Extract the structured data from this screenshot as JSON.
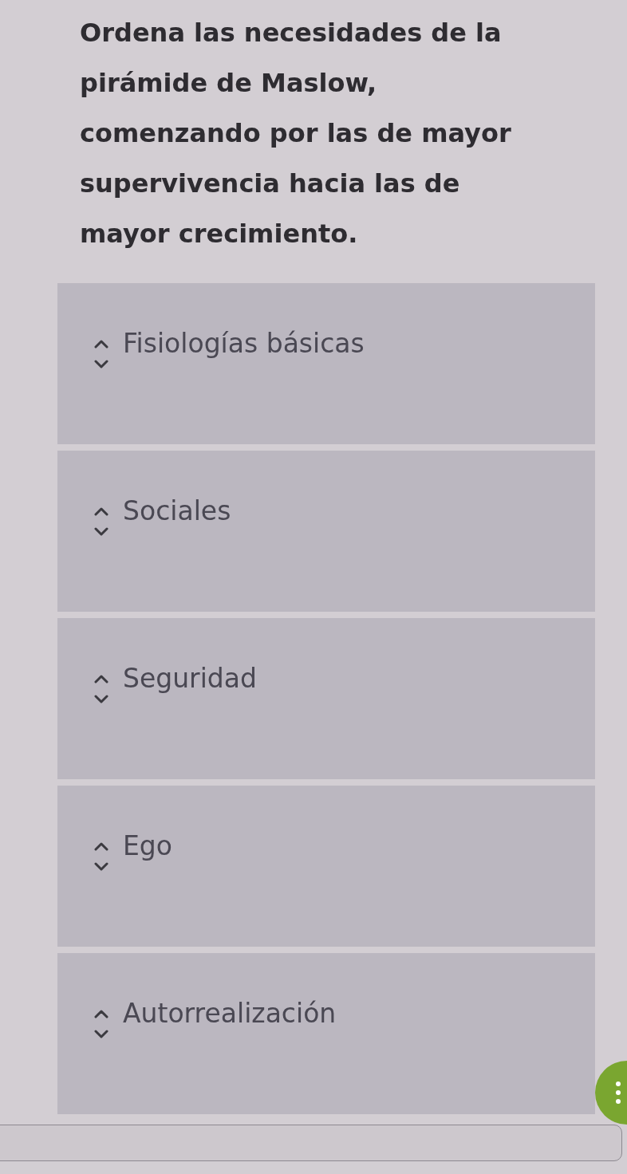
{
  "question": {
    "text": "Ordena las necesidades de la pirámide de Maslow, comenzando por las de mayor supervivencia hacia las de mayor crecimiento."
  },
  "items": [
    {
      "label": "Fisiologías básicas"
    },
    {
      "label": "Sociales"
    },
    {
      "label": "Seguridad"
    },
    {
      "label": "Ego"
    },
    {
      "label": "Autorrealización"
    }
  ]
}
